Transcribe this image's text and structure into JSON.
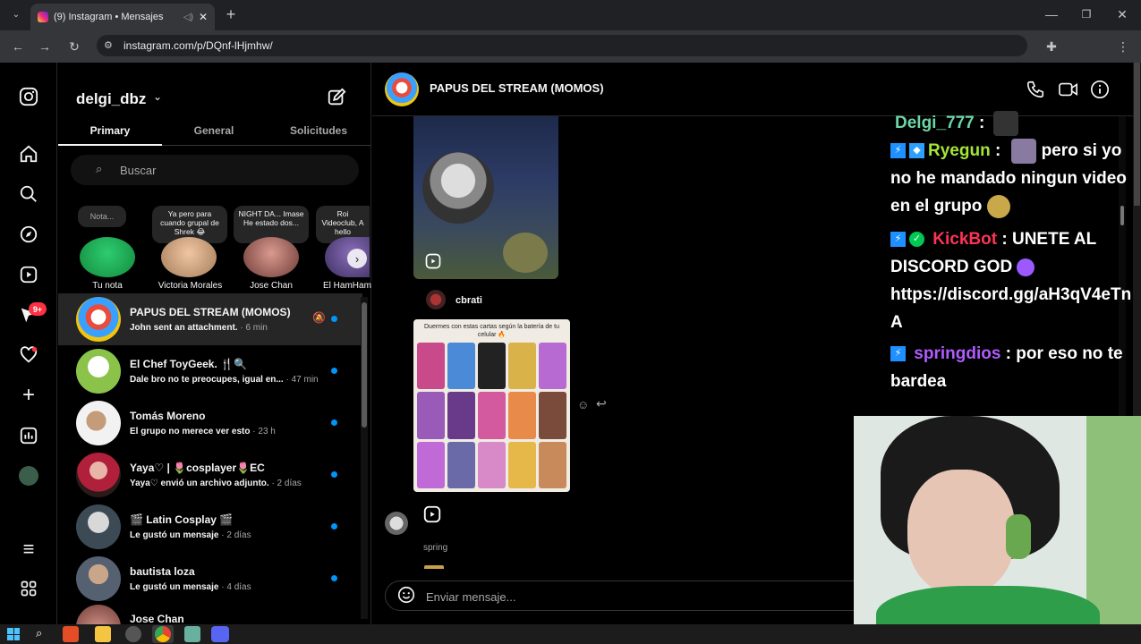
{
  "browser": {
    "tab_title": "(9) Instagram • Mensajes",
    "url": "instagram.com/p/DQnf-lHjmhw/"
  },
  "sidebar": {
    "notif_badge": "9+"
  },
  "inbox": {
    "username": "delgi_dbz",
    "tabs": [
      {
        "label": "Primary",
        "active": true
      },
      {
        "label": "General"
      },
      {
        "label": "Solicitudes"
      }
    ],
    "search_placeholder": "Buscar",
    "notes": [
      {
        "bubble": "Nota...",
        "name": "Tu nota"
      },
      {
        "bubble": "Ya pero para cuando grupal de Shrek 😂",
        "name": "Victoria Morales"
      },
      {
        "bubble": "NIGHT DA... Imase He estado dos...",
        "name": "Jose Chan"
      },
      {
        "bubble": "Roi Videoclub, A hello",
        "name": "El HamHam"
      }
    ],
    "conversations": [
      {
        "name": "PAPUS DEL STREAM (MOMOS)",
        "preview": "John sent an attachment.",
        "time": "· 6 min",
        "muted": true
      },
      {
        "name": "El Chef ToyGeek. 🍴🔍",
        "preview": "Dale bro no te preocupes, igual en...",
        "time": "· 47 min"
      },
      {
        "name": "Tomás Moreno",
        "preview": "El grupo no merece ver esto",
        "time": "· 23 h"
      },
      {
        "name": "Yaya♡ | 🌷cosplayer🌷EC",
        "preview": "Yaya♡ envió un archivo adjunto.",
        "time": "· 2 días"
      },
      {
        "name": "🎬 Latin Cosplay 🎬",
        "preview": "Le gustó un mensaje",
        "time": "· 2 días"
      },
      {
        "name": "bautista loza",
        "preview": "Le gustó un mensaje",
        "time": "· 4 días"
      },
      {
        "name": "Jose Chan",
        "preview": "",
        "time": ""
      }
    ]
  },
  "chat": {
    "title": "PAPUS DEL STREAM (MOMOS)",
    "sender1": "cbrati",
    "meme_caption": "Duermes con estas cartas según la batería de tu celular 🔥",
    "sender2": "spring",
    "input_placeholder": "Enviar mensaje..."
  },
  "stream_chat": [
    {
      "user": "Delgi_777",
      "sep": " : ",
      "text": ""
    },
    {
      "user": "Ryegun",
      "sep": " : ",
      "text": "pero si yo no he mandado ningun video en el grupo"
    },
    {
      "user": "KickBot",
      "sep": " : ",
      "text": "UNETE AL DISCORD GOD"
    },
    {
      "user": "",
      "sep": "",
      "text": "https://discord.gg/aH3qV4eTnA"
    },
    {
      "user": "springdios",
      "sep": " : ",
      "text": "por eso no te bardea"
    }
  ]
}
